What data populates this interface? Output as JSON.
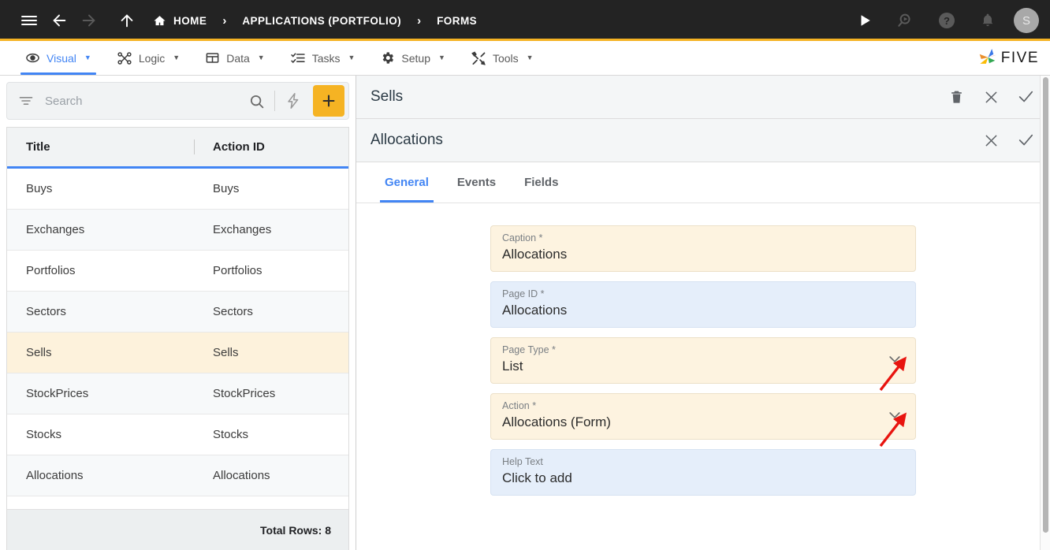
{
  "topbar": {
    "icons": {
      "menu": "hamburger-icon",
      "back": "back-arrow-icon",
      "forward": "forward-arrow-icon",
      "up": "up-arrow-icon",
      "run": "play-icon",
      "search": "search-magnifier-icon",
      "help": "help-circle-icon",
      "notifications": "bell-icon"
    },
    "breadcrumbs": [
      {
        "label": "HOME",
        "icon": "home-icon"
      },
      {
        "label": "APPLICATIONS (PORTFOLIO)",
        "icon": ""
      },
      {
        "label": "FORMS",
        "icon": ""
      }
    ],
    "separator": "›",
    "avatar_initial": "S"
  },
  "menubar": {
    "items": [
      {
        "label": "Visual",
        "icon": "eye-icon",
        "active": true
      },
      {
        "label": "Logic",
        "icon": "nodes-icon",
        "active": false
      },
      {
        "label": "Data",
        "icon": "table-icon",
        "active": false
      },
      {
        "label": "Tasks",
        "icon": "checklist-icon",
        "active": false
      },
      {
        "label": "Setup",
        "icon": "gear-icon",
        "active": false
      },
      {
        "label": "Tools",
        "icon": "tools-icon",
        "active": false
      }
    ],
    "caret": "▼",
    "brand": "FIVE"
  },
  "sidebar": {
    "search": {
      "placeholder": "Search",
      "value": ""
    },
    "buttons": {
      "filter": "filter-icon",
      "search": "search-icon",
      "lightning": "lightning-icon",
      "add": "plus-icon",
      "add_label": "+"
    },
    "table": {
      "columns": [
        "Title",
        "Action ID"
      ],
      "rows": [
        {
          "title": "Buys",
          "action_id": "Buys",
          "selected": false
        },
        {
          "title": "Exchanges",
          "action_id": "Exchanges",
          "selected": false
        },
        {
          "title": "Portfolios",
          "action_id": "Portfolios",
          "selected": false
        },
        {
          "title": "Sectors",
          "action_id": "Sectors",
          "selected": false
        },
        {
          "title": "Sells",
          "action_id": "Sells",
          "selected": true
        },
        {
          "title": "StockPrices",
          "action_id": "StockPrices",
          "selected": false
        },
        {
          "title": "Stocks",
          "action_id": "Stocks",
          "selected": false
        },
        {
          "title": "Allocations",
          "action_id": "Allocations",
          "selected": false
        }
      ],
      "footer": "Total Rows: 8"
    }
  },
  "detail": {
    "outer": {
      "title": "Sells",
      "actions": {
        "delete": "trash-icon",
        "close": "close-icon",
        "confirm": "check-icon"
      }
    },
    "inner": {
      "title": "Allocations",
      "actions": {
        "close": "close-icon",
        "confirm": "check-icon"
      }
    },
    "tabs": [
      {
        "label": "General",
        "active": true
      },
      {
        "label": "Events",
        "active": false
      },
      {
        "label": "Fields",
        "active": false
      }
    ],
    "fields": [
      {
        "label": "Caption *",
        "value": "Allocations",
        "style": "cream",
        "dropdown": false,
        "annotated": false
      },
      {
        "label": "Page ID *",
        "value": "Allocations",
        "style": "blue",
        "dropdown": false,
        "annotated": false
      },
      {
        "label": "Page Type *",
        "value": "List",
        "style": "cream",
        "dropdown": true,
        "annotated": true
      },
      {
        "label": "Action *",
        "value": "Allocations (Form)",
        "style": "cream",
        "dropdown": true,
        "annotated": true
      },
      {
        "label": "Help Text",
        "value": "Click to add",
        "style": "blue",
        "dropdown": false,
        "annotated": false
      }
    ]
  },
  "colors": {
    "topbar_bg": "#232323",
    "accent_yellow": "#f5b323",
    "accent_blue": "#4285f4",
    "selected_row": "#fdf2dc",
    "field_cream": "#fdf3e0",
    "field_blue": "#e5eefa",
    "annotation_red": "#e8140f"
  }
}
